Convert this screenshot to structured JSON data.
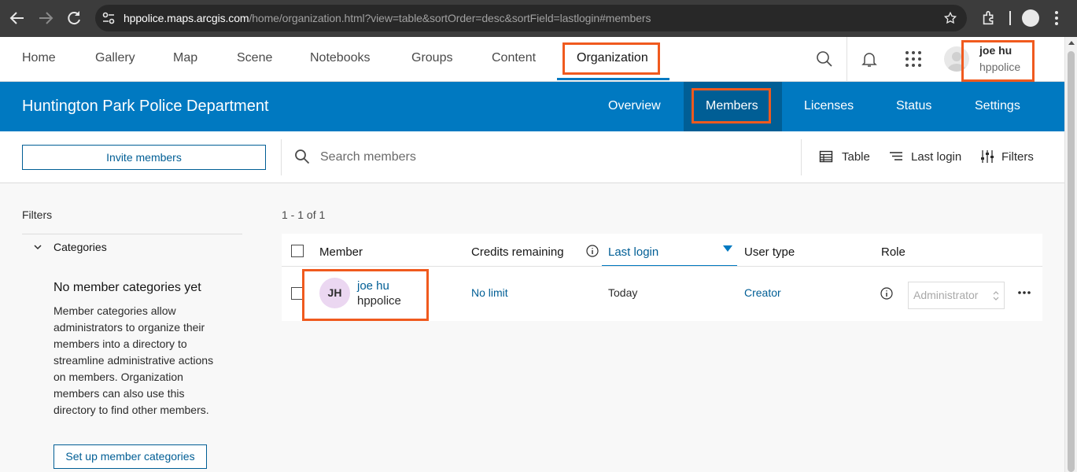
{
  "browser": {
    "url_host": "hppolice.maps.arcgis.com",
    "url_path": "/home/organization.html?view=table&sortOrder=desc&sortField=lastlogin#members"
  },
  "topnav": {
    "items": [
      "Home",
      "Gallery",
      "Map",
      "Scene",
      "Notebooks",
      "Groups",
      "Content",
      "Organization"
    ],
    "active": "Organization",
    "user_name": "joe hu",
    "user_org": "hppolice"
  },
  "org": {
    "title": "Huntington Park Police Department",
    "tabs": [
      "Overview",
      "Members",
      "Licenses",
      "Status",
      "Settings"
    ],
    "active_tab": "Members"
  },
  "toolbar": {
    "invite_label": "Invite members",
    "search_placeholder": "Search members",
    "view_label": "Table",
    "sort_label": "Last login",
    "filters_label": "Filters"
  },
  "filters": {
    "title": "Filters",
    "category_label": "Categories",
    "empty_title": "No member categories yet",
    "empty_desc": "Member categories allow administrators to organize their members into a directory to streamline administrative actions on members. Organization members can also use this directory to find other members.",
    "setup_label": "Set up member categories"
  },
  "results": {
    "count": "1 - 1 of 1",
    "columns": {
      "member": "Member",
      "credits": "Credits remaining",
      "last_login": "Last login",
      "user_type": "User type",
      "role": "Role"
    },
    "rows": [
      {
        "initials": "JH",
        "name": "joe hu",
        "username": "hppolice",
        "credits": "No limit",
        "last_login": "Today",
        "user_type": "Creator",
        "role": "Administrator"
      }
    ]
  },
  "colors": {
    "brand_blue": "#0079c1",
    "dark_blue": "#005e95",
    "highlight": "#f05a1e"
  }
}
